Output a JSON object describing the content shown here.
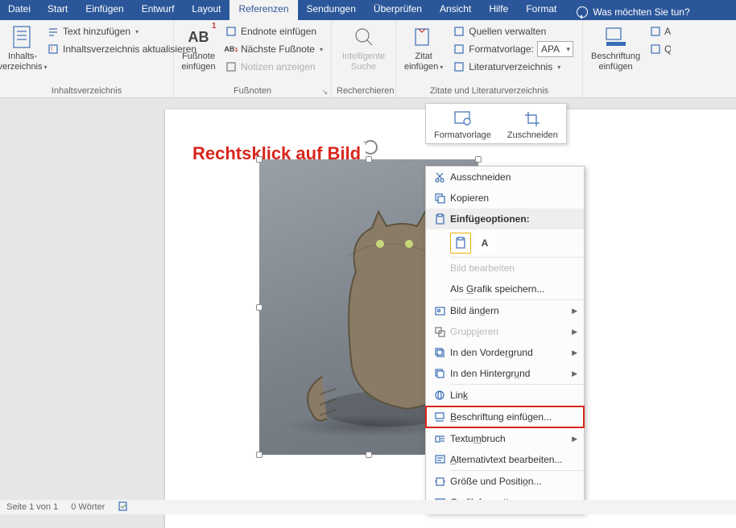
{
  "tabs": {
    "file": "Datei",
    "start": "Start",
    "insert": "Einfügen",
    "design": "Entwurf",
    "layout": "Layout",
    "references": "Referenzen",
    "mailings": "Sendungen",
    "review": "Überprüfen",
    "view": "Ansicht",
    "help": "Hilfe",
    "format": "Format",
    "tellme": "Was möchten Sie tun?"
  },
  "ribbon": {
    "toc": {
      "main": "Inhalts-\nverzeichnis",
      "add_text": "Text hinzufügen",
      "update": "Inhaltsverzeichnis aktualisieren",
      "group": "Inhaltsverzeichnis"
    },
    "footnotes": {
      "main": "Fußnote\neinfügen",
      "ab": "AB",
      "ab_sup": "1",
      "endnote": "Endnote einfügen",
      "next": "Nächste Fußnote",
      "show": "Notizen anzeigen",
      "group": "Fußnoten"
    },
    "research": {
      "main": "Intelligente\nSuche",
      "group": "Recherchieren"
    },
    "citations": {
      "main": "Zitat\neinfügen",
      "manage": "Quellen verwalten",
      "style_label": "Formatvorlage:",
      "style_value": "APA",
      "biblio": "Literaturverzeichnis",
      "group": "Zitate und Literaturverzeichnis"
    },
    "captions": {
      "main": "Beschriftung\neinfügen",
      "cross1": "Ab",
      "cross2": "Qu"
    }
  },
  "annotation": "Rechtsklick auf Bild",
  "minitoolbar": {
    "style": "Formatvorlage",
    "crop": "Zuschneiden"
  },
  "context_menu": {
    "cut": "Ausschneiden",
    "copy": "Kopieren",
    "paste_header": "Einfügeoptionen:",
    "paste_a": "A",
    "edit_image": "Bild bearbeiten",
    "save_as_graphic": "Als Grafik speichern...",
    "change_image": "Bild ändern",
    "group": "Gruppieren",
    "bring_front": "In den Vordergrund",
    "send_back": "In den Hintergrund",
    "link": "Link",
    "insert_caption": "Beschriftung einfügen...",
    "text_wrap": "Textumbruch",
    "alt_text": "Alternativtext bearbeiten...",
    "size_pos": "Größe und Position...",
    "format_graphic": "Grafik formatieren..."
  },
  "status": {
    "page": "Seite 1 von 1",
    "words": "0 Wörter"
  }
}
